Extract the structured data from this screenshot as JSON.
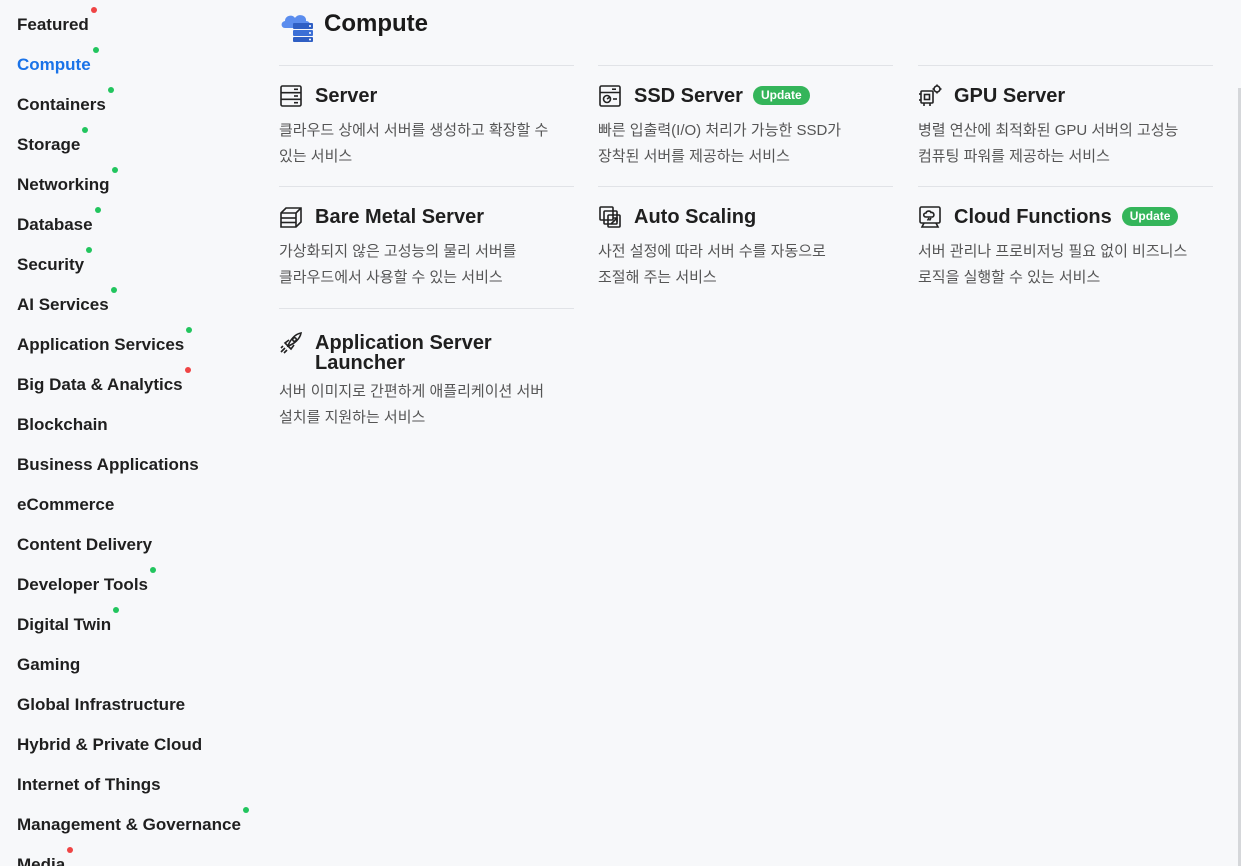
{
  "sidebar": {
    "items": [
      {
        "label": "Featured",
        "dot": "red"
      },
      {
        "label": "Compute",
        "dot": "green",
        "active": true
      },
      {
        "label": "Containers",
        "dot": "green"
      },
      {
        "label": "Storage",
        "dot": "green"
      },
      {
        "label": "Networking",
        "dot": "green"
      },
      {
        "label": "Database",
        "dot": "green"
      },
      {
        "label": "Security",
        "dot": "green"
      },
      {
        "label": "AI Services",
        "dot": "green"
      },
      {
        "label": "Application Services",
        "dot": "green"
      },
      {
        "label": "Big Data & Analytics",
        "dot": "red"
      },
      {
        "label": "Blockchain",
        "dot": ""
      },
      {
        "label": "Business Applications",
        "dot": ""
      },
      {
        "label": "eCommerce",
        "dot": ""
      },
      {
        "label": "Content Delivery",
        "dot": ""
      },
      {
        "label": "Developer Tools",
        "dot": "green"
      },
      {
        "label": "Digital Twin",
        "dot": "green"
      },
      {
        "label": "Gaming",
        "dot": ""
      },
      {
        "label": "Global Infrastructure",
        "dot": ""
      },
      {
        "label": "Hybrid & Private Cloud",
        "dot": ""
      },
      {
        "label": "Internet of Things",
        "dot": ""
      },
      {
        "label": "Management & Governance",
        "dot": "green"
      },
      {
        "label": "Media",
        "dot": "red"
      }
    ]
  },
  "header": {
    "title": "Compute",
    "icon": "cloud-server-icon"
  },
  "cards": [
    {
      "title": "Server",
      "icon": "server-icon",
      "badge": "",
      "desc_lines": [
        "클라우드 상에서 서버를 생성하고 확장할 수",
        "있는 서비스"
      ]
    },
    {
      "title": "SSD Server",
      "icon": "ssd-server-icon",
      "badge": "Update",
      "desc_lines": [
        "빠른 입출력(I/O) 처리가 가능한 SSD가",
        "장착된 서버를 제공하는 서비스"
      ]
    },
    {
      "title": "GPU Server",
      "icon": "gpu-chip-icon",
      "badge": "",
      "desc_lines": [
        "병렬 연산에 최적화된 GPU 서버의 고성능",
        "컴퓨팅 파워를 제공하는 서비스"
      ]
    },
    {
      "title": "Bare Metal Server",
      "icon": "bare-metal-icon",
      "badge": "",
      "desc_lines": [
        "가상화되지 않은 고성능의 물리 서버를",
        "클라우드에서 사용할 수 있는 서비스"
      ]
    },
    {
      "title": "Auto Scaling",
      "icon": "auto-scaling-icon",
      "badge": "",
      "desc_lines": [
        "사전 설정에 따라 서버 수를 자동으로",
        "조절해 주는 서비스"
      ]
    },
    {
      "title": "Cloud Functions",
      "icon": "cloud-functions-icon",
      "badge": "Update",
      "desc_lines": [
        "서버 관리나 프로비저닝 필요 없이 비즈니스",
        "로직을 실행할 수 있는 서비스"
      ]
    },
    {
      "title_lines": [
        "Application Server",
        "Launcher"
      ],
      "icon": "rocket-icon",
      "badge": "",
      "desc_lines": [
        "서버 이미지로 간편하게 애플리케이션 서버",
        "설치를 지원하는 서비스"
      ]
    }
  ],
  "colors": {
    "accent": "#1a73e8",
    "badge": "#34b55a",
    "dot_green": "#22c55e",
    "dot_red": "#ef4444"
  }
}
